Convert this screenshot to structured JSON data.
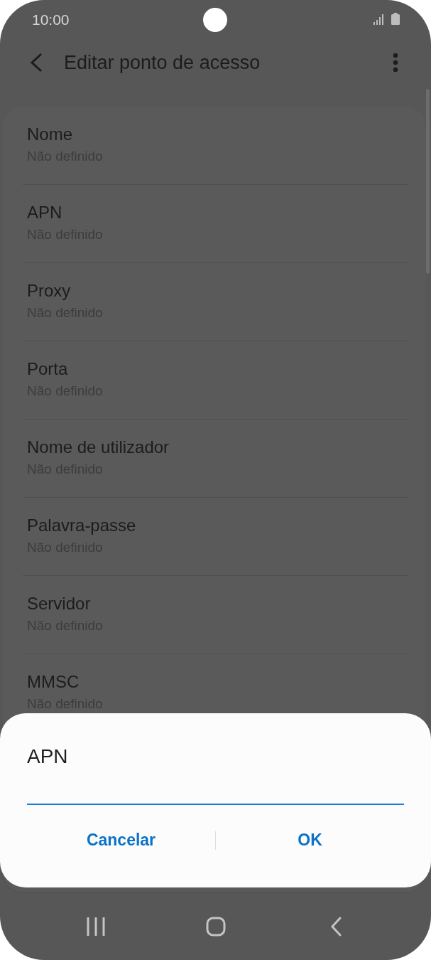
{
  "status_bar": {
    "time": "10:00"
  },
  "toolbar": {
    "title": "Editar ponto de acesso"
  },
  "settings": [
    {
      "title": "Nome",
      "value": "Não definido"
    },
    {
      "title": "APN",
      "value": "Não definido"
    },
    {
      "title": "Proxy",
      "value": "Não definido"
    },
    {
      "title": "Porta",
      "value": "Não definido"
    },
    {
      "title": "Nome de utilizador",
      "value": "Não definido"
    },
    {
      "title": "Palavra-passe",
      "value": "Não definido"
    },
    {
      "title": "Servidor",
      "value": "Não definido"
    },
    {
      "title": "MMSC",
      "value": "Não definido"
    }
  ],
  "dialog": {
    "title": "APN",
    "buttons": [
      "Cancelar",
      "OK"
    ]
  }
}
